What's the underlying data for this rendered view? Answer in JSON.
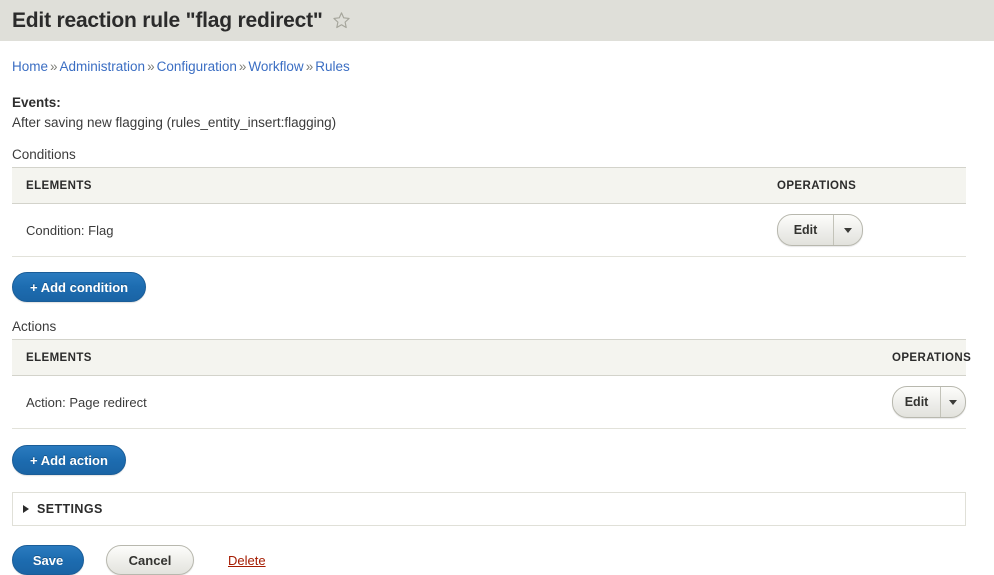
{
  "header": {
    "title": "Edit reaction rule \"flag redirect\"",
    "star_icon": "star-outline-icon",
    "background": "#dfdfd9"
  },
  "breadcrumb": {
    "separator": "»",
    "items": [
      {
        "label": "Home"
      },
      {
        "label": "Administration"
      },
      {
        "label": "Configuration"
      },
      {
        "label": "Workflow"
      },
      {
        "label": "Rules"
      }
    ]
  },
  "events": {
    "label": "Events:",
    "value": "After saving new flagging (rules_entity_insert:flagging)"
  },
  "conditions": {
    "section_label": "Conditions",
    "columns": {
      "elements": "ELEMENTS",
      "operations": "OPERATIONS"
    },
    "rows": [
      {
        "element": "Condition: Flag",
        "op_label": "Edit",
        "op_caret": "chevron-down-icon"
      }
    ],
    "add_button": "+ Add condition"
  },
  "actions": {
    "section_label": "Actions",
    "columns": {
      "elements": "ELEMENTS",
      "operations": "OPERATIONS"
    },
    "rows": [
      {
        "element": "Action: Page redirect",
        "op_label": "Edit",
        "op_caret": "chevron-down-icon"
      }
    ],
    "add_button": "+ Add action"
  },
  "settings": {
    "summary": "SETTINGS",
    "expanded": false,
    "caret": "caret-right-icon"
  },
  "form_actions": {
    "save": "Save",
    "cancel": "Cancel",
    "delete": "Delete"
  },
  "colors": {
    "primary_blue": "#1d6cb0",
    "link_blue": "#3b6ec3",
    "delete_red": "#a51b00",
    "header_band": "#dfdfd9",
    "table_head": "#f4f4ef"
  }
}
